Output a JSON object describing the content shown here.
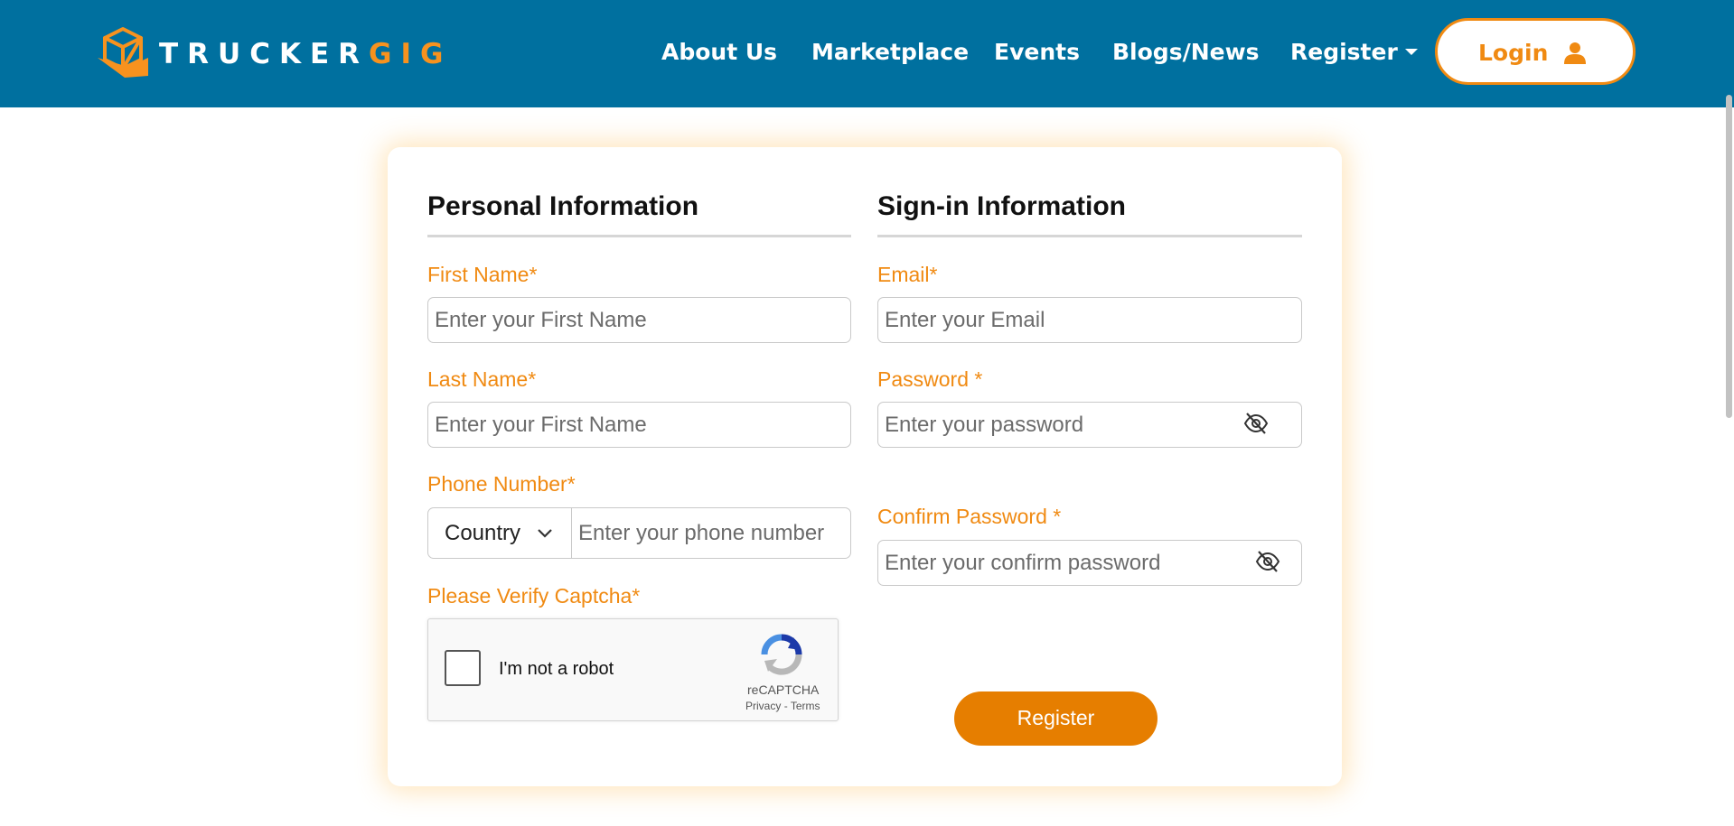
{
  "brand": {
    "logo_text_main": "TRUCKER",
    "logo_text_accent": "GIG",
    "colors": {
      "primary": "#00709f",
      "accent": "#f08a12",
      "button": "#e67e00"
    }
  },
  "nav": {
    "items": [
      {
        "label": "About Us"
      },
      {
        "label": "Marketplace"
      },
      {
        "label": "Events"
      },
      {
        "label": "Blogs/News"
      },
      {
        "label": "Register",
        "has_dropdown": true
      }
    ],
    "login_label": "Login",
    "login_icon": "user-icon"
  },
  "form": {
    "personal": {
      "heading": "Personal Information",
      "first_name": {
        "label": "First Name*",
        "placeholder": "Enter your First Name"
      },
      "last_name": {
        "label": "Last Name*",
        "placeholder": "Enter your First Name"
      },
      "phone": {
        "label": "Phone Number*",
        "country": "Country",
        "placeholder": "Enter your phone number"
      },
      "captcha": {
        "label": "Please Verify Captcha*",
        "checkbox_text": "I'm not a robot",
        "brand": "reCAPTCHA",
        "privacy": "Privacy",
        "separator": "-",
        "terms": "Terms"
      }
    },
    "signin": {
      "heading": "Sign-in Information",
      "email": {
        "label": "Email*",
        "placeholder": "Enter your Email"
      },
      "password": {
        "label": "Password *",
        "placeholder": "Enter your password",
        "icon": "eye-off-icon"
      },
      "confirm": {
        "label": "Confirm Password *",
        "placeholder": "Enter your confirm password",
        "icon": "eye-off-icon"
      }
    },
    "submit_label": "Register"
  }
}
